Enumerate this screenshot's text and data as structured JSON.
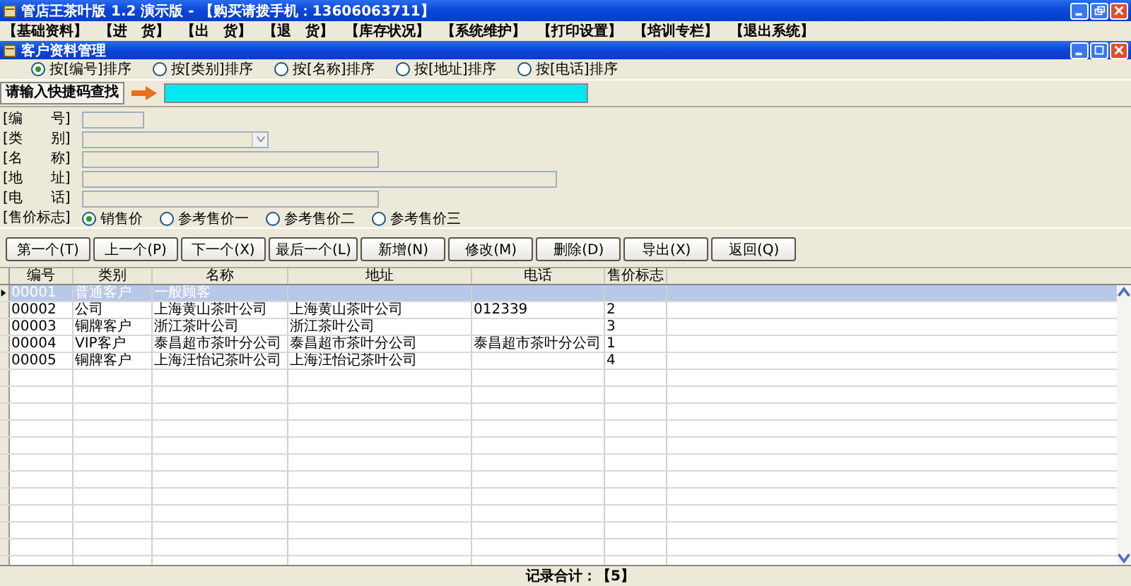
{
  "app_window": {
    "title": "管店王茶叶版 1.2 演示版 - 【购买请拨手机：13606063711】"
  },
  "menu": [
    "【基础资料】",
    "【进　货】",
    "【出　货】",
    "【退　货】",
    "【库存状况】",
    "【系统维护】",
    "【打印设置】",
    "【培训专栏】",
    "【退出系统】"
  ],
  "child_window": {
    "title": "客户资料管理"
  },
  "sort_options": [
    {
      "label": "按[编号]排序",
      "selected": true
    },
    {
      "label": "按[类别]排序",
      "selected": false
    },
    {
      "label": "按[名称]排序",
      "selected": false
    },
    {
      "label": "按[地址]排序",
      "selected": false
    },
    {
      "label": "按[电话]排序",
      "selected": false
    }
  ],
  "search": {
    "label": "请输入快捷码查找"
  },
  "form_fields": [
    {
      "label": "[编　　号]",
      "kind": "short"
    },
    {
      "label": "[类　　别]",
      "kind": "combo"
    },
    {
      "label": "[名　　称]",
      "kind": "medium"
    },
    {
      "label": "[地　　址]",
      "kind": "long"
    },
    {
      "label": "[电　　话]",
      "kind": "medium"
    }
  ],
  "price_flag": {
    "label": "[售价标志]",
    "options": [
      {
        "label": "销售价",
        "selected": true
      },
      {
        "label": "参考售价一",
        "selected": false
      },
      {
        "label": "参考售价二",
        "selected": false
      },
      {
        "label": "参考售价三",
        "selected": false
      }
    ]
  },
  "buttons": [
    "第一个(T)",
    "上一个(P)",
    "下一个(X)",
    "最后一个(L)",
    "新增(N)",
    "修改(M)",
    "删除(D)",
    "导出(X)",
    "返回(Q)"
  ],
  "table": {
    "columns": [
      "编号",
      "类别",
      "名称",
      "地址",
      "电话",
      "售价标志"
    ],
    "rows": [
      {
        "selected": true,
        "cells": [
          "00001",
          "普通客户",
          "一般顾客",
          "",
          "",
          ""
        ]
      },
      {
        "selected": false,
        "cells": [
          "00002",
          "公司",
          "上海黄山茶叶公司",
          "上海黄山茶叶公司",
          "012339",
          "2"
        ]
      },
      {
        "selected": false,
        "cells": [
          "00003",
          "铜牌客户",
          "浙江茶叶公司",
          "浙江茶叶公司",
          "",
          "3"
        ]
      },
      {
        "selected": false,
        "cells": [
          "00004",
          "VIP客户",
          "泰昌超市茶叶分公司",
          "泰昌超市茶叶分公司",
          "泰昌超市茶叶分公司",
          "1"
        ]
      },
      {
        "selected": false,
        "cells": [
          "00005",
          "铜牌客户",
          "上海汪怡记茶叶公司",
          "上海汪怡记茶叶公司",
          "",
          "4"
        ]
      }
    ]
  },
  "status_bar": "记录合计：【5】"
}
